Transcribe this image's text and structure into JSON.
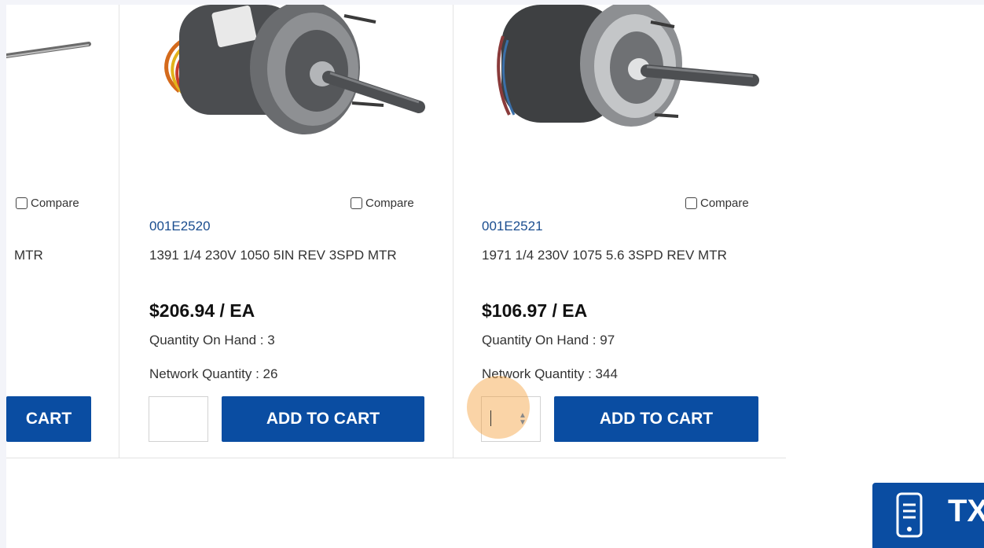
{
  "products": [
    {
      "compare_label": "Compare",
      "description": "MTR",
      "button_label": "CART"
    },
    {
      "compare_label": "Compare",
      "sku": "001E2520",
      "description": "1391 1/4 230V 1050 5IN REV 3SPD MTR",
      "price": "$206.94 / EA",
      "quantity_on_hand": "Quantity On Hand : 3",
      "network_quantity": "Network Quantity : 26",
      "qty_value": "",
      "button_label": "ADD TO CART"
    },
    {
      "compare_label": "Compare",
      "sku": "001E2521",
      "description": "1971 1/4 230V 1075 5.6 3SPD REV MTR",
      "price": "$106.97 / EA",
      "quantity_on_hand": "Quantity On Hand : 97",
      "network_quantity": "Network Quantity : 344",
      "qty_value": "",
      "button_label": "ADD TO CART"
    }
  ],
  "badge": {
    "text": "TX",
    "icon": "phone-icon"
  },
  "colors": {
    "primary": "#0a4da2",
    "sku": "#1a4d8f",
    "cursor_halo": "#f4a03c"
  }
}
